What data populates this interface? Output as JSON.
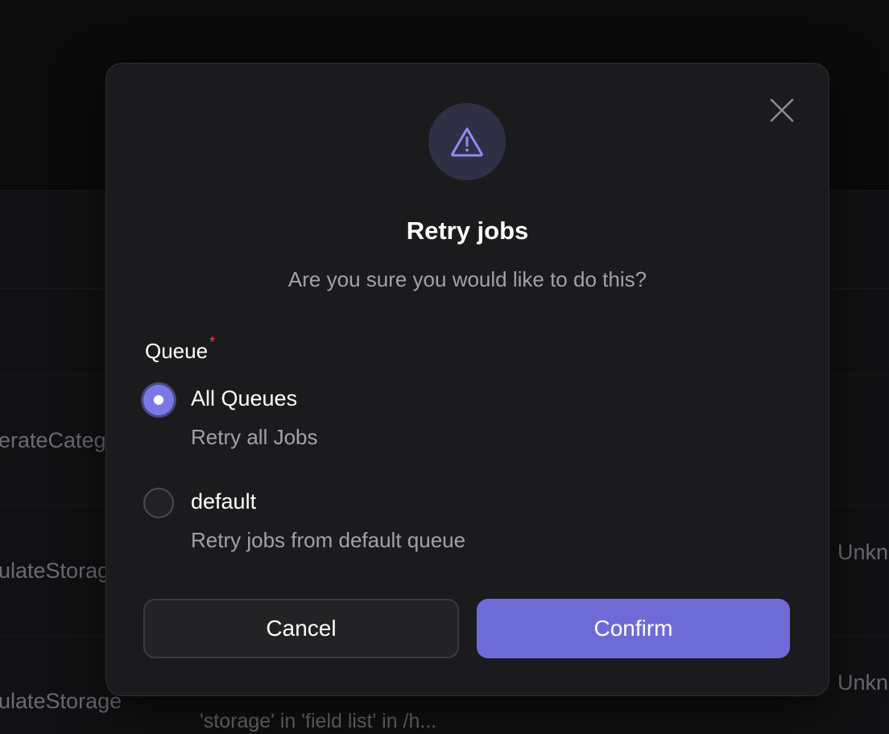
{
  "background": {
    "rows": [
      {
        "left_text": "erateCateg",
        "right_text": ""
      },
      {
        "left_text": "ulateStorag",
        "right_text": "Unkn"
      },
      {
        "left_text": "ulateStorage",
        "right_text": "Unkn"
      }
    ],
    "bottom_text": "'storage' in 'field list' in /h..."
  },
  "dialog": {
    "title": "Retry jobs",
    "subtitle": "Are you sure you would like to do this?",
    "field_label": "Queue",
    "required_mark": "*",
    "options": [
      {
        "label": "All Queues",
        "description": "Retry all Jobs",
        "selected": true
      },
      {
        "label": "default",
        "description": "Retry jobs from default queue",
        "selected": false
      }
    ],
    "cancel_label": "Cancel",
    "confirm_label": "Confirm"
  },
  "icons": {
    "close": "close-icon",
    "warning": "warning-triangle-icon"
  },
  "colors": {
    "accent": "#6e6bd8",
    "modal_bg": "#1b1b1e",
    "warning_icon": "#8f8cf0",
    "required": "#e5484d"
  }
}
